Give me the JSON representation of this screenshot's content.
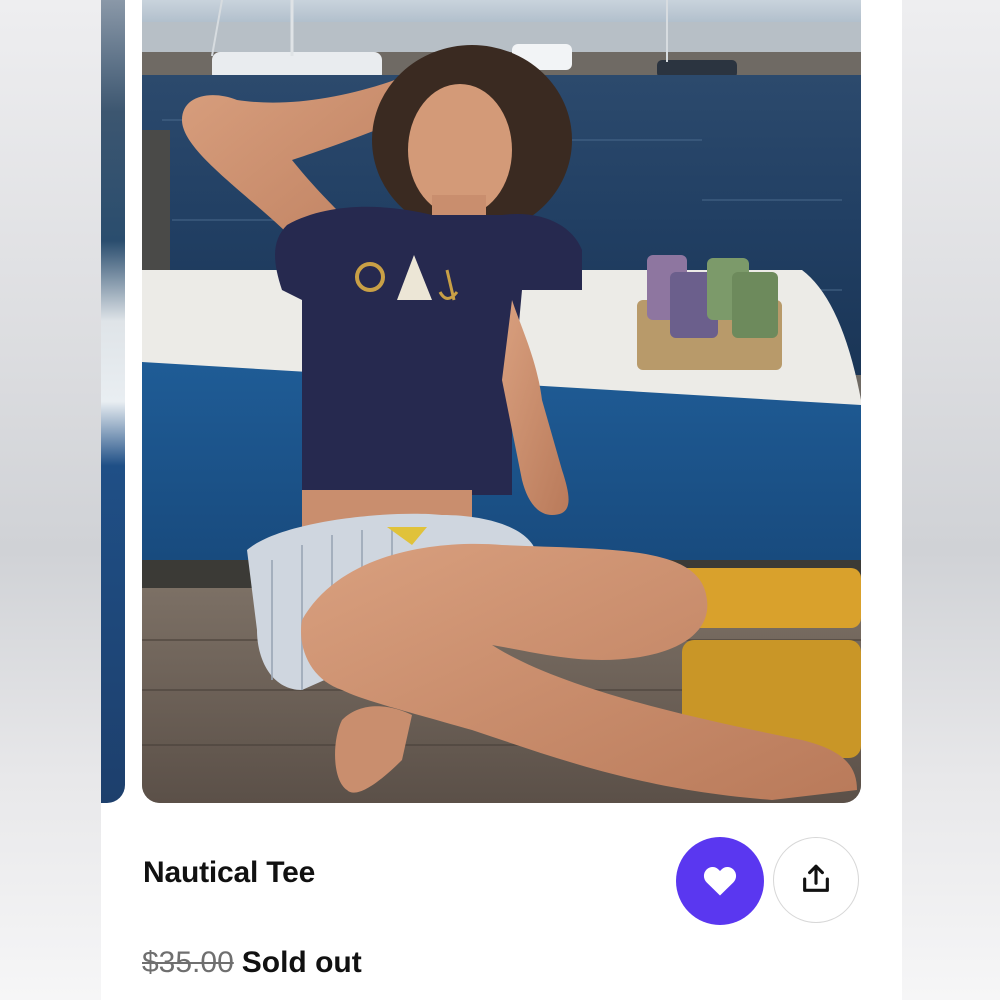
{
  "product": {
    "title": "Nautical Tee",
    "original_price": "$35.00",
    "status": "Sold out"
  },
  "actions": {
    "favorite_icon": "heart-icon",
    "share_icon": "share-icon"
  },
  "colors": {
    "accent": "#5a37f0",
    "text": "#111111",
    "muted_price": "#6f6f6f"
  },
  "gallery": {
    "image_subject": "photo"
  }
}
